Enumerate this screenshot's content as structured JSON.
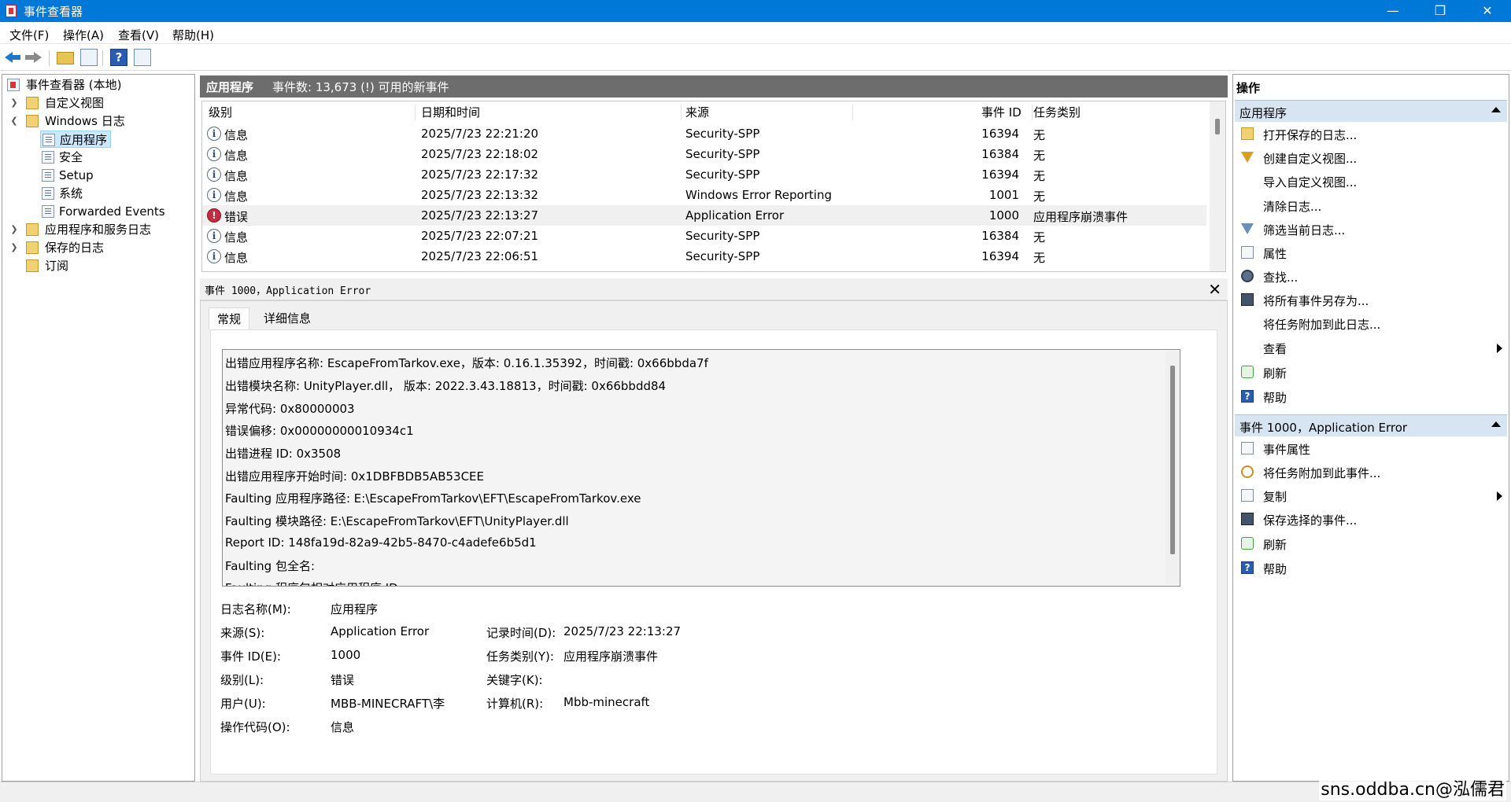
{
  "window": {
    "title": "事件查看器"
  },
  "menu": [
    "文件(F)",
    "操作(A)",
    "查看(V)",
    "帮助(H)"
  ],
  "tree": {
    "root": "事件查看器 (本地)",
    "custom_views": "自定义视图",
    "windows_logs": "Windows 日志",
    "application": "应用程序",
    "security": "安全",
    "setup": "Setup",
    "system": "系统",
    "forwarded": "Forwarded Events",
    "app_service_logs": "应用程序和服务日志",
    "saved_logs": "保存的日志",
    "subscriptions": "订阅"
  },
  "center": {
    "log_name": "应用程序",
    "event_count": "事件数: 13,673 (!) 可用的新事件"
  },
  "columns": [
    "级别",
    "日期和时间",
    "来源",
    "事件 ID",
    "任务类别"
  ],
  "events": [
    {
      "level": "信息",
      "type": "info",
      "datetime": "2025/7/23 22:21:20",
      "source": "Security-SPP",
      "id": "16394",
      "task": "无"
    },
    {
      "level": "信息",
      "type": "info",
      "datetime": "2025/7/23 22:18:02",
      "source": "Security-SPP",
      "id": "16384",
      "task": "无"
    },
    {
      "level": "信息",
      "type": "info",
      "datetime": "2025/7/23 22:17:32",
      "source": "Security-SPP",
      "id": "16394",
      "task": "无"
    },
    {
      "level": "信息",
      "type": "info",
      "datetime": "2025/7/23 22:13:32",
      "source": "Windows Error Reporting",
      "id": "1001",
      "task": "无"
    },
    {
      "level": "错误",
      "type": "error",
      "datetime": "2025/7/23 22:13:27",
      "source": "Application Error",
      "id": "1000",
      "task": "应用程序崩溃事件"
    },
    {
      "level": "信息",
      "type": "info",
      "datetime": "2025/7/23 22:07:21",
      "source": "Security-SPP",
      "id": "16384",
      "task": "无"
    },
    {
      "level": "信息",
      "type": "info",
      "datetime": "2025/7/23 22:06:51",
      "source": "Security-SPP",
      "id": "16394",
      "task": "无"
    }
  ],
  "detail": {
    "header": "事件 1000，Application Error",
    "tabs": [
      "常规",
      "详细信息"
    ],
    "description": [
      "出错应用程序名称:   EscapeFromTarkov.exe，版本:   0.16.1.35392，时间戳:   0x66bbda7f",
      "出错模块名称:   UnityPlayer.dll，  版本:   2022.3.43.18813，时间戳:   0x66bbdd84",
      "异常代码:   0x80000003",
      "错误偏移:   0x00000000010934c1",
      "出错进程 ID:   0x3508",
      "出错应用程序开始时间:   0x1DBFBDB5AB53CEE",
      "Faulting 应用程序路径:   E:\\EscapeFromTarkov\\EFT\\EscapeFromTarkov.exe",
      "Faulting 模块路径:   E:\\EscapeFromTarkov\\EFT\\UnityPlayer.dll",
      "Report ID:   148fa19d-82a9-42b5-8470-c4adefe6b5d1",
      "Faulting 包全名:",
      "Faulting 程序包相对应用程序 ID:"
    ],
    "fields": {
      "log_name_label": "日志名称(M):",
      "log_name": "应用程序",
      "source_label": "来源(S):",
      "source": "Application Error",
      "logged_label": "记录时间(D):",
      "logged": "2025/7/23 22:13:27",
      "event_id_label": "事件 ID(E):",
      "event_id": "1000",
      "task_label": "任务类别(Y):",
      "task": "应用程序崩溃事件",
      "level_label": "级别(L):",
      "level": "错误",
      "keywords_label": "关键字(K):",
      "keywords": "",
      "user_label": "用户(U):",
      "user": "MBB-MINECRAFT\\李",
      "computer_label": "计算机(R):",
      "computer": "Mbb-minecraft",
      "opcode_label": "操作代码(O):",
      "opcode": "信息"
    }
  },
  "actions": {
    "title": "操作",
    "section1": "应用程序",
    "items1": [
      "打开保存的日志...",
      "创建自定义视图...",
      "导入自定义视图...",
      "清除日志...",
      "筛选当前日志...",
      "属性",
      "查找...",
      "将所有事件另存为...",
      "将任务附加到此日志...",
      "查看",
      "刷新",
      "帮助"
    ],
    "section2": "事件 1000，Application Error",
    "items2": [
      "事件属性",
      "将任务附加到此事件...",
      "复制",
      "保存选择的事件...",
      "刷新",
      "帮助"
    ]
  },
  "watermark": "sns.oddba.cn@泓儒君",
  "colors": {
    "titlebar": "#0078d7",
    "selection": "#cce8ff",
    "section": "#d7e5f3",
    "error": "#c42b42"
  }
}
